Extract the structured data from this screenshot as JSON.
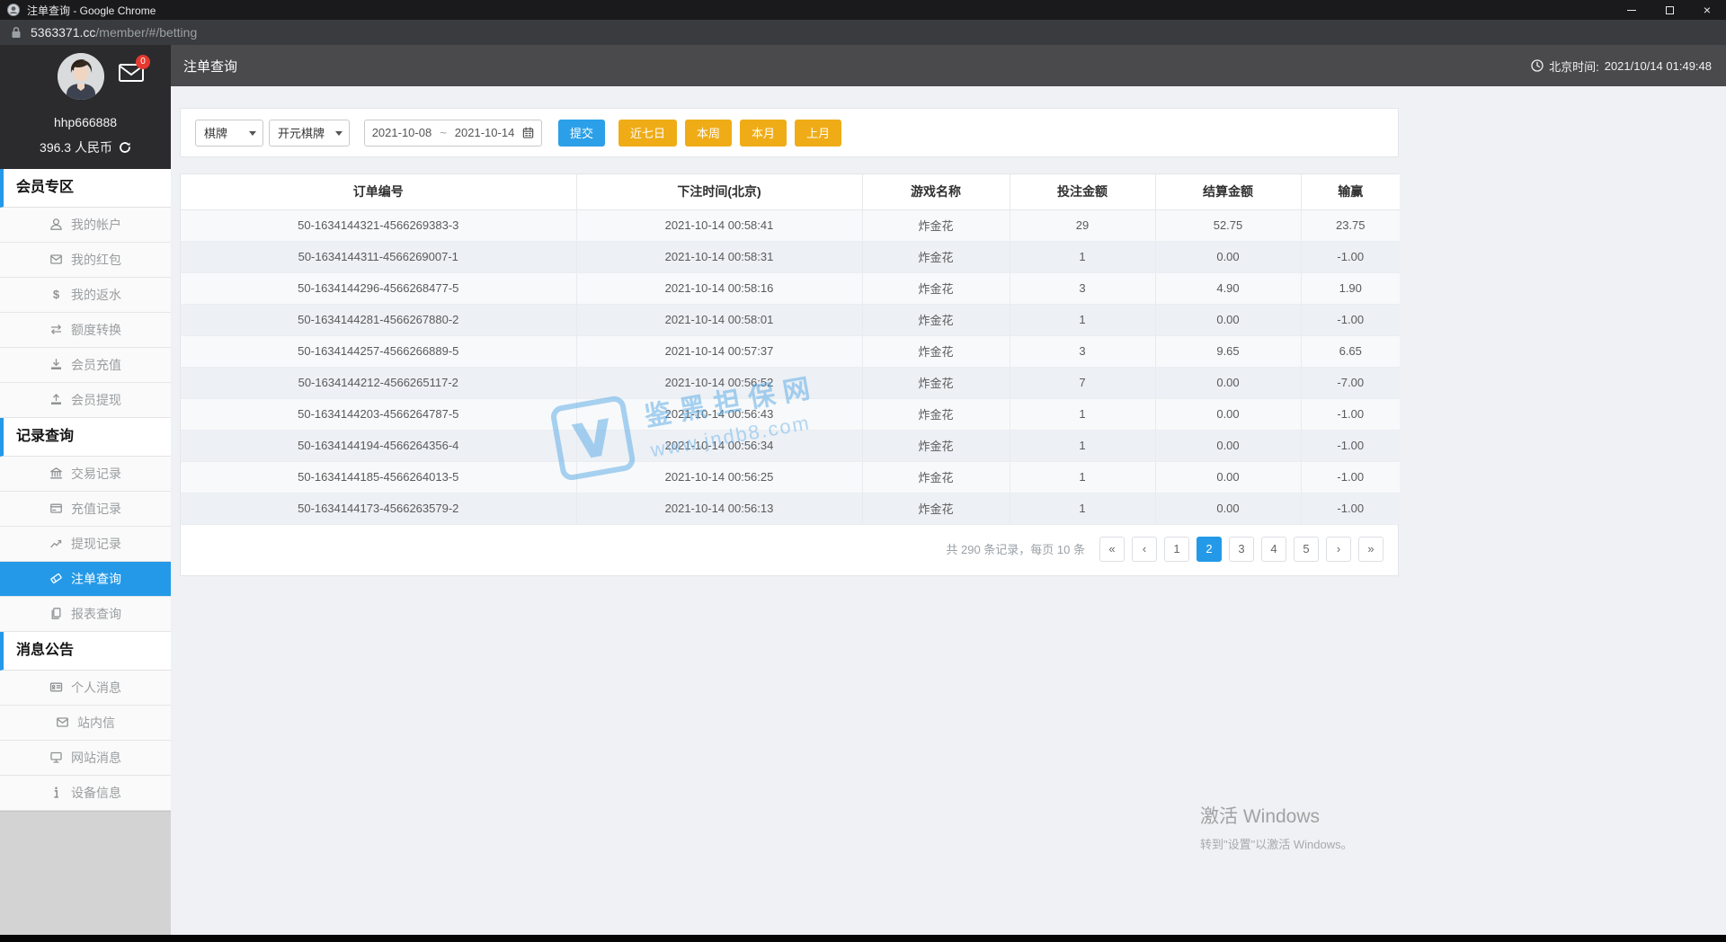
{
  "window": {
    "title": "注单查询 - Google Chrome",
    "url_host": "5363371.cc",
    "url_path": "/member/#/betting",
    "close_glyph": "×"
  },
  "user": {
    "name": "hhp666888",
    "balance": "396.3 人民币",
    "mail_badge": "0"
  },
  "sidebar": {
    "sections": [
      {
        "title": "会员专区",
        "items": [
          {
            "icon": "user-icon",
            "label": "我的帐户"
          },
          {
            "icon": "red-packet-icon",
            "label": "我的红包"
          },
          {
            "icon": "rebate-icon",
            "label": "我的返水"
          },
          {
            "icon": "transfer-icon",
            "label": "额度转换"
          },
          {
            "icon": "deposit-icon",
            "label": "会员充值"
          },
          {
            "icon": "withdraw-icon",
            "label": "会员提现"
          }
        ]
      },
      {
        "title": "记录查询",
        "items": [
          {
            "icon": "bank-icon",
            "label": "交易记录"
          },
          {
            "icon": "recharge-record-icon",
            "label": "充值记录"
          },
          {
            "icon": "withdraw-record-icon",
            "label": "提现记录"
          },
          {
            "icon": "ticket-icon",
            "label": "注单查询",
            "active": true
          },
          {
            "icon": "report-icon",
            "label": "报表查询"
          }
        ]
      },
      {
        "title": "消息公告",
        "items": [
          {
            "icon": "personal-message-icon",
            "label": "个人消息"
          },
          {
            "icon": "inbox-icon",
            "label": "站内信"
          },
          {
            "icon": "site-message-icon",
            "label": "网站消息"
          },
          {
            "icon": "device-info-icon",
            "label": "设备信息"
          }
        ]
      }
    ]
  },
  "page": {
    "title": "注单查询",
    "clock_prefix": "北京时间:",
    "clock_time": "2021/10/14 01:49:48"
  },
  "filters": {
    "category": "棋牌",
    "vendor": "开元棋牌",
    "date_start": "2021-10-08",
    "date_separator": "~",
    "date_end": "2021-10-14",
    "submit": "提交",
    "quick": [
      "近七日",
      "本周",
      "本月",
      "上月"
    ]
  },
  "table": {
    "headers": [
      "订单编号",
      "下注时间(北京)",
      "游戏名称",
      "投注金额",
      "结算金额",
      "输赢"
    ],
    "rows": [
      [
        "50-1634144321-4566269383-3",
        "2021-10-14 00:58:41",
        "炸金花",
        "29",
        "52.75",
        "23.75"
      ],
      [
        "50-1634144311-4566269007-1",
        "2021-10-14 00:58:31",
        "炸金花",
        "1",
        "0.00",
        "-1.00"
      ],
      [
        "50-1634144296-4566268477-5",
        "2021-10-14 00:58:16",
        "炸金花",
        "3",
        "4.90",
        "1.90"
      ],
      [
        "50-1634144281-4566267880-2",
        "2021-10-14 00:58:01",
        "炸金花",
        "1",
        "0.00",
        "-1.00"
      ],
      [
        "50-1634144257-4566266889-5",
        "2021-10-14 00:57:37",
        "炸金花",
        "3",
        "9.65",
        "6.65"
      ],
      [
        "50-1634144212-4566265117-2",
        "2021-10-14 00:56:52",
        "炸金花",
        "7",
        "0.00",
        "-7.00"
      ],
      [
        "50-1634144203-4566264787-5",
        "2021-10-14 00:56:43",
        "炸金花",
        "1",
        "0.00",
        "-1.00"
      ],
      [
        "50-1634144194-4566264356-4",
        "2021-10-14 00:56:34",
        "炸金花",
        "1",
        "0.00",
        "-1.00"
      ],
      [
        "50-1634144185-4566264013-5",
        "2021-10-14 00:56:25",
        "炸金花",
        "1",
        "0.00",
        "-1.00"
      ],
      [
        "50-1634144173-4566263579-2",
        "2021-10-14 00:56:13",
        "炸金花",
        "1",
        "0.00",
        "-1.00"
      ]
    ]
  },
  "pagination": {
    "summary": "共 290 条记录，每页 10 条",
    "first": "«",
    "prev": "‹",
    "pages": [
      "1",
      "2",
      "3",
      "4",
      "5"
    ],
    "active_page": "2",
    "next": "›",
    "last": "»"
  },
  "watermark": {
    "line1": "鉴黑担保网",
    "line2": "www.jndb8.com"
  },
  "activation": {
    "line1": "激活 Windows",
    "line2": "转到\"设置\"以激活 Windows。"
  },
  "colors": {
    "accent_blue": "#2499e8",
    "button_yellow": "#efac17",
    "badge_red": "#e6392f",
    "header_dark": "#4a4a4d"
  }
}
